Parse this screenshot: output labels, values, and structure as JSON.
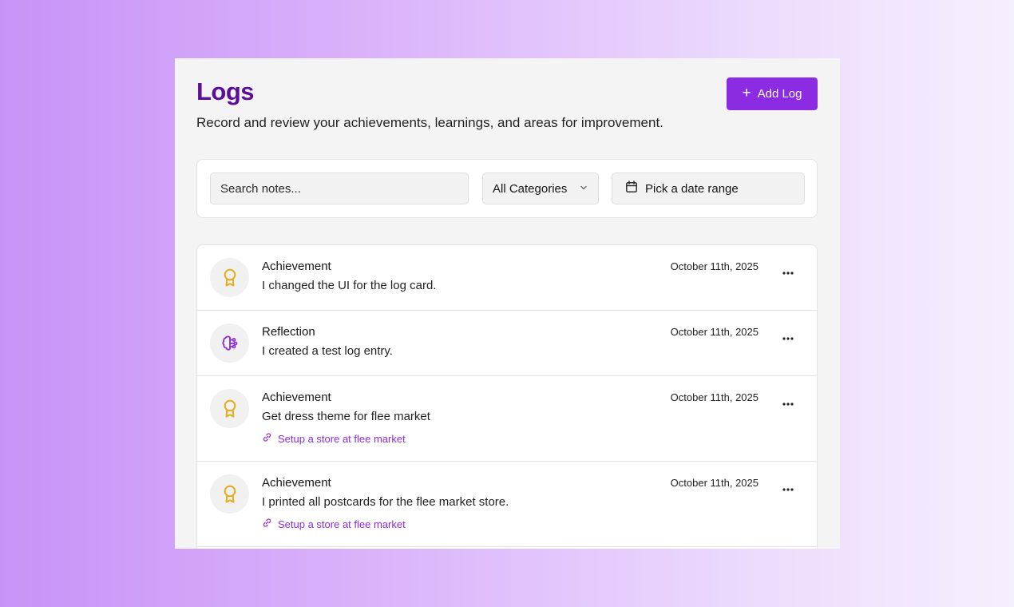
{
  "header": {
    "title": "Logs",
    "subtitle": "Record and review your achievements, learnings, and areas for improvement.",
    "add_button_label": "Add Log"
  },
  "filters": {
    "search_placeholder": "Search notes...",
    "category_selected": "All Categories",
    "date_range_label": "Pick a date range"
  },
  "colors": {
    "accent": "#8b2be2",
    "title": "#5b0f98",
    "achievement_icon": "#e7ac16",
    "reflection_icon": "#8b2be2"
  },
  "logs": [
    {
      "category": "Achievement",
      "icon": "award-icon",
      "note": "I changed the UI for the log card.",
      "date": "October 11th, 2025",
      "link": ""
    },
    {
      "category": "Reflection",
      "icon": "brain-icon",
      "note": "I created a test log entry.",
      "date": "October 11th, 2025",
      "link": ""
    },
    {
      "category": "Achievement",
      "icon": "award-icon",
      "note": "Get dress theme for flee market",
      "date": "October 11th, 2025",
      "link": "Setup a store at flee market"
    },
    {
      "category": "Achievement",
      "icon": "award-icon",
      "note": "I printed all postcards for the flee market store.",
      "date": "October 11th, 2025",
      "link": "Setup a store at flee market"
    }
  ]
}
